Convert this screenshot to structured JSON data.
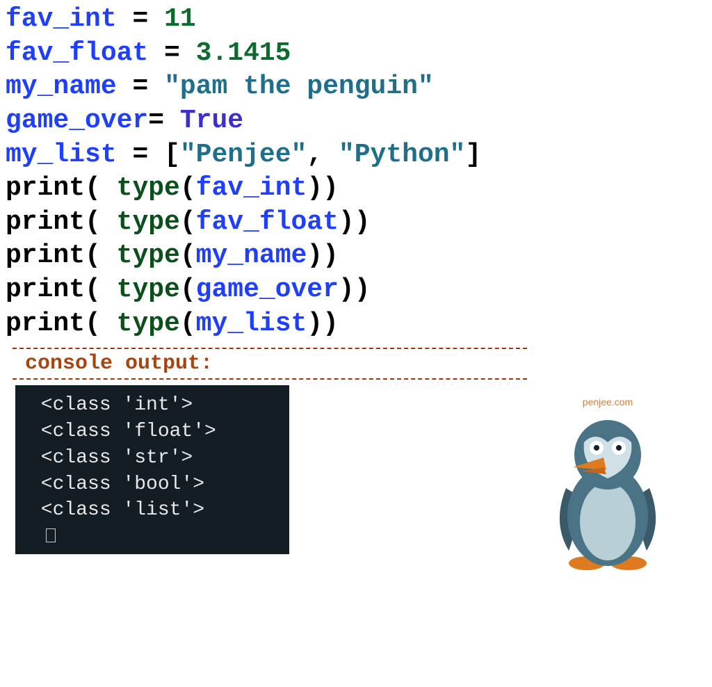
{
  "code": {
    "lines": [
      {
        "type": "assign",
        "var": "fav_int",
        "val_kind": "num",
        "val": "11"
      },
      {
        "type": "assign",
        "var": "fav_float",
        "val_kind": "num",
        "val": "3.1415"
      },
      {
        "type": "assign",
        "var": "my_name",
        "val_kind": "str",
        "val": "\"pam the penguin\""
      },
      {
        "type": "assign_nospace",
        "var": "game_over",
        "val_kind": "bool",
        "val": "True"
      },
      {
        "type": "assign_list",
        "var": "my_list",
        "items": [
          "\"Penjee\"",
          "\"Python\""
        ]
      },
      {
        "type": "print_type",
        "arg": "fav_int"
      },
      {
        "type": "print_type",
        "arg": "fav_float"
      },
      {
        "type": "print_type",
        "arg": "my_name"
      },
      {
        "type": "print_type",
        "arg": "game_over"
      },
      {
        "type": "print_type",
        "arg": "my_list"
      }
    ],
    "print_fn": "print",
    "type_fn": "type"
  },
  "console": {
    "label": "console output:",
    "lines": [
      "<class 'int'>",
      "<class 'float'>",
      "<class 'str'>",
      "<class 'bool'>",
      "<class 'list'>"
    ]
  },
  "penguin": {
    "caption": "penjee.com"
  }
}
